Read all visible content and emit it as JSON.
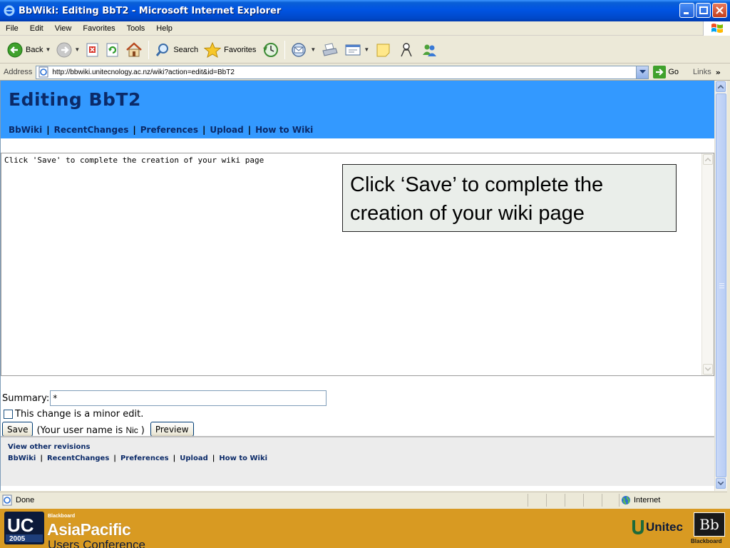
{
  "window": {
    "title": "BbWiki: Editing BbT2 - Microsoft Internet Explorer"
  },
  "menu": [
    "File",
    "Edit",
    "View",
    "Favorites",
    "Tools",
    "Help"
  ],
  "toolbar": {
    "back_label": "Back",
    "search_label": "Search",
    "favorites_label": "Favorites"
  },
  "address": {
    "label": "Address",
    "url": "http://bbwiki.unitecnology.ac.nz/wiki?action=edit&id=BbT2",
    "go_label": "Go",
    "links_label": "Links"
  },
  "page": {
    "title": "Editing BbT2",
    "nav": [
      "BbWiki",
      "RecentChanges",
      "Preferences",
      "Upload",
      "How to Wiki"
    ],
    "editor_text": "Click 'Save' to complete the creation of your wiki page",
    "callout": "Click ‘Save’ to complete the creation of your wiki page",
    "summary_label": "Summary:",
    "summary_value": "*",
    "minor_edit_label": "This change is a minor edit.",
    "save_label": "Save",
    "username_note_prefix": "(Your user name is",
    "username": "Nic",
    "username_note_suffix": ")",
    "preview_label": "Preview",
    "footer_other_revisions": "View other revisions",
    "footer_nav": [
      "BbWiki",
      "RecentChanges",
      "Preferences",
      "Upload",
      "How to Wiki"
    ]
  },
  "status": {
    "text": "Done",
    "zone": "Internet"
  },
  "banner": {
    "brand_small": "Blackboard",
    "brand_main": "AsiaPacific",
    "brand_sub": "Users Conference",
    "uc_text": "UC",
    "uc_year": "2005",
    "unitec": "Unitec",
    "bb_mark": "Bb",
    "bb_word": "Blackboard"
  },
  "colors": {
    "titlebar": "#0054e3",
    "page_header": "#3399ff",
    "nav_link": "#0b2a68",
    "banner": "#d89a22"
  }
}
